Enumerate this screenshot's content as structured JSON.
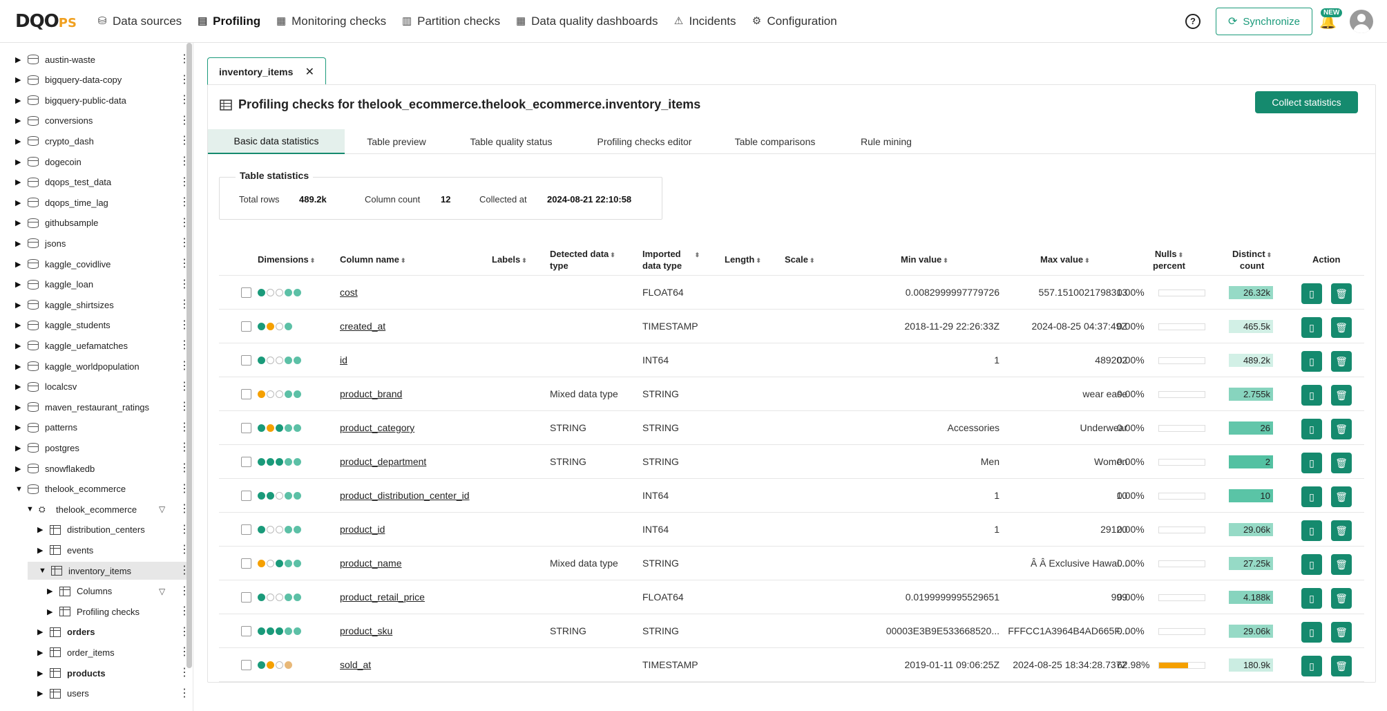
{
  "header": {
    "logo_main": "DQO",
    "logo_suffix": "PS",
    "nav": [
      {
        "label": "Data sources",
        "icon": "data-sources-icon",
        "active": false
      },
      {
        "label": "Profiling",
        "icon": "profiling-icon",
        "active": true
      },
      {
        "label": "Monitoring checks",
        "icon": "monitoring-icon",
        "active": false
      },
      {
        "label": "Partition checks",
        "icon": "partition-icon",
        "active": false
      },
      {
        "label": "Data quality dashboards",
        "icon": "dashboard-icon",
        "active": false
      },
      {
        "label": "Incidents",
        "icon": "warning-icon",
        "active": false
      },
      {
        "label": "Configuration",
        "icon": "gear-icon",
        "active": false
      }
    ],
    "help_label": "?",
    "sync_label": "Synchronize",
    "new_badge": "NEW"
  },
  "sidebar": {
    "items": [
      {
        "label": "austin-waste",
        "level": 0,
        "type": "db",
        "expanded": false
      },
      {
        "label": "bigquery-data-copy",
        "level": 0,
        "type": "db",
        "expanded": false
      },
      {
        "label": "bigquery-public-data",
        "level": 0,
        "type": "db",
        "expanded": false
      },
      {
        "label": "conversions",
        "level": 0,
        "type": "db",
        "expanded": false
      },
      {
        "label": "crypto_dash",
        "level": 0,
        "type": "db",
        "expanded": false
      },
      {
        "label": "dogecoin",
        "level": 0,
        "type": "db",
        "expanded": false
      },
      {
        "label": "dqops_test_data",
        "level": 0,
        "type": "db",
        "expanded": false
      },
      {
        "label": "dqops_time_lag",
        "level": 0,
        "type": "db",
        "expanded": false
      },
      {
        "label": "githubsample",
        "level": 0,
        "type": "db",
        "expanded": false
      },
      {
        "label": "jsons",
        "level": 0,
        "type": "db",
        "expanded": false
      },
      {
        "label": "kaggle_covidlive",
        "level": 0,
        "type": "db",
        "expanded": false
      },
      {
        "label": "kaggle_loan",
        "level": 0,
        "type": "db",
        "expanded": false
      },
      {
        "label": "kaggle_shirtsizes",
        "level": 0,
        "type": "db",
        "expanded": false
      },
      {
        "label": "kaggle_students",
        "level": 0,
        "type": "db",
        "expanded": false
      },
      {
        "label": "kaggle_uefamatches",
        "level": 0,
        "type": "db",
        "expanded": false
      },
      {
        "label": "kaggle_worldpopulation",
        "level": 0,
        "type": "db",
        "expanded": false
      },
      {
        "label": "localcsv",
        "level": 0,
        "type": "db",
        "expanded": false
      },
      {
        "label": "maven_restaurant_ratings",
        "level": 0,
        "type": "db",
        "expanded": false
      },
      {
        "label": "patterns",
        "level": 0,
        "type": "db",
        "expanded": false
      },
      {
        "label": "postgres",
        "level": 0,
        "type": "db",
        "expanded": false
      },
      {
        "label": "snowflakedb",
        "level": 0,
        "type": "db",
        "expanded": false
      },
      {
        "label": "thelook_ecommerce",
        "level": 0,
        "type": "db",
        "expanded": true
      },
      {
        "label": "thelook_ecommerce",
        "level": 1,
        "type": "schema",
        "expanded": true,
        "filter": true
      },
      {
        "label": "distribution_centers",
        "level": 2,
        "type": "table",
        "expanded": false
      },
      {
        "label": "events",
        "level": 2,
        "type": "table",
        "expanded": false
      },
      {
        "label": "inventory_items",
        "level": 2,
        "type": "table",
        "expanded": true,
        "selected": true
      },
      {
        "label": "Columns",
        "level": 3,
        "type": "columns",
        "expanded": false,
        "filter": true
      },
      {
        "label": "Profiling checks",
        "level": 3,
        "type": "checks",
        "expanded": false
      },
      {
        "label": "orders",
        "level": 2,
        "type": "table",
        "expanded": false,
        "bold": true
      },
      {
        "label": "order_items",
        "level": 2,
        "type": "table",
        "expanded": false
      },
      {
        "label": "products",
        "level": 2,
        "type": "table",
        "expanded": false,
        "bold": true
      },
      {
        "label": "users",
        "level": 2,
        "type": "table",
        "expanded": false
      }
    ]
  },
  "doc_tab": {
    "label": "inventory_items",
    "close": "✕"
  },
  "panel": {
    "title": "Profiling checks for thelook_ecommerce.thelook_ecommerce.inventory_items",
    "collect_label": "Collect statistics",
    "tabs": [
      "Basic data statistics",
      "Table preview",
      "Table quality status",
      "Profiling checks editor",
      "Table comparisons",
      "Rule mining"
    ],
    "active_tab": 0
  },
  "table_stats": {
    "legend": "Table statistics",
    "total_rows_label": "Total rows",
    "total_rows": "489.2k",
    "column_count_label": "Column count",
    "column_count": "12",
    "collected_at_label": "Collected at",
    "collected_at": "2024-08-21 22:10:58"
  },
  "columns_table": {
    "headers": {
      "dimensions": "Dimensions",
      "column_name": "Column name",
      "labels": "Labels",
      "detected_1": "Detected data",
      "detected_2": "type",
      "imported_1": "Imported",
      "imported_2": "data type",
      "length": "Length",
      "scale": "Scale",
      "min": "Min value",
      "max": "Max value",
      "nulls_1": "Nulls",
      "nulls_2": "percent",
      "distinct_1": "Distinct",
      "distinct_2": "count",
      "action": "Action"
    },
    "rows": [
      {
        "name": "cost",
        "dims": [
          "#1a9a7a",
          "empty",
          "empty",
          "#5cc0a6",
          "#5cc0a6"
        ],
        "detected": "",
        "imported": "FLOAT64",
        "min": "0.0082999997779726",
        "max": "557.1510021798313",
        "nulls": "0.00%",
        "nulls_pct": 0,
        "distinct": "26.32k",
        "distinct_level": 0.5
      },
      {
        "name": "created_at",
        "dims": [
          "#1a9a7a",
          "#f5a000",
          "empty",
          "#5cc0a6"
        ],
        "detected": "",
        "imported": "TIMESTAMP",
        "min": "2018-11-29 22:26:33Z",
        "max": "2024-08-25 04:37:49Z",
        "nulls": "0.00%",
        "nulls_pct": 0,
        "distinct": "465.5k",
        "distinct_level": 0.1
      },
      {
        "name": "id",
        "dims": [
          "#1a9a7a",
          "empty",
          "empty",
          "#5cc0a6",
          "#5cc0a6"
        ],
        "detected": "",
        "imported": "INT64",
        "min": "1",
        "max": "489202",
        "nulls": "0.00%",
        "nulls_pct": 0,
        "distinct": "489.2k",
        "distinct_level": 0.1
      },
      {
        "name": "product_brand",
        "dims": [
          "#f5a000",
          "empty",
          "empty",
          "#5cc0a6",
          "#5cc0a6"
        ],
        "detected": "Mixed data type",
        "imported": "STRING",
        "min": "",
        "max": "wear ease",
        "nulls": "0.00%",
        "nulls_pct": 0,
        "distinct": "2.755k",
        "distinct_level": 0.6
      },
      {
        "name": "product_category",
        "dims": [
          "#1a9a7a",
          "#f5a000",
          "#1a9a7a",
          "#5cc0a6",
          "#5cc0a6"
        ],
        "detected": "STRING",
        "imported": "STRING",
        "min": "Accessories",
        "max": "Underwear",
        "nulls": "0.00%",
        "nulls_pct": 0,
        "distinct": "26",
        "distinct_level": 0.85
      },
      {
        "name": "product_department",
        "dims": [
          "#1a9a7a",
          "#1a9a7a",
          "#1a9a7a",
          "#5cc0a6",
          "#5cc0a6"
        ],
        "detected": "STRING",
        "imported": "STRING",
        "min": "Men",
        "max": "Women",
        "nulls": "0.00%",
        "nulls_pct": 0,
        "distinct": "2",
        "distinct_level": 0.95
      },
      {
        "name": "product_distribution_center_id",
        "dims": [
          "#1a9a7a",
          "#1a9a7a",
          "empty",
          "#5cc0a6",
          "#5cc0a6"
        ],
        "detected": "",
        "imported": "INT64",
        "min": "1",
        "max": "10",
        "nulls": "0.00%",
        "nulls_pct": 0,
        "distinct": "10",
        "distinct_level": 0.9
      },
      {
        "name": "product_id",
        "dims": [
          "#1a9a7a",
          "empty",
          "empty",
          "#5cc0a6",
          "#5cc0a6"
        ],
        "detected": "",
        "imported": "INT64",
        "min": "1",
        "max": "29120",
        "nulls": "0.00%",
        "nulls_pct": 0,
        "distinct": "29.06k",
        "distinct_level": 0.5
      },
      {
        "name": "product_name",
        "dims": [
          "#f5a000",
          "empty",
          "#1a9a7a",
          "#5cc0a6",
          "#5cc0a6"
        ],
        "detected": "Mixed data type",
        "imported": "STRING",
        "min": "",
        "max": "Â Â Exclusive Hawai...",
        "nulls": "0.00%",
        "nulls_pct": 0,
        "distinct": "27.25k",
        "distinct_level": 0.5
      },
      {
        "name": "product_retail_price",
        "dims": [
          "#1a9a7a",
          "empty",
          "empty",
          "#5cc0a6",
          "#5cc0a6"
        ],
        "detected": "",
        "imported": "FLOAT64",
        "min": "0.0199999995529651",
        "max": "999",
        "nulls": "0.00%",
        "nulls_pct": 0,
        "distinct": "4.188k",
        "distinct_level": 0.6
      },
      {
        "name": "product_sku",
        "dims": [
          "#1a9a7a",
          "#1a9a7a",
          "#1a9a7a",
          "#5cc0a6",
          "#5cc0a6"
        ],
        "detected": "STRING",
        "imported": "STRING",
        "min": "00003E3B9E533668520...",
        "max": "FFFCC1A3964B4AD665F...",
        "nulls": "0.00%",
        "nulls_pct": 0,
        "distinct": "29.06k",
        "distinct_level": 0.5
      },
      {
        "name": "sold_at",
        "dims": [
          "#1a9a7a",
          "#f5a000",
          "empty",
          "#e8b878"
        ],
        "detected": "",
        "imported": "TIMESTAMP",
        "min": "2019-01-11 09:06:25Z",
        "max": "2024-08-25 18:34:28.737Z",
        "nulls": "62.98%",
        "nulls_pct": 0.63,
        "distinct": "180.9k",
        "distinct_level": 0.15
      }
    ]
  },
  "colors": {
    "accent": "#158a6e",
    "warning": "#f5a000"
  }
}
